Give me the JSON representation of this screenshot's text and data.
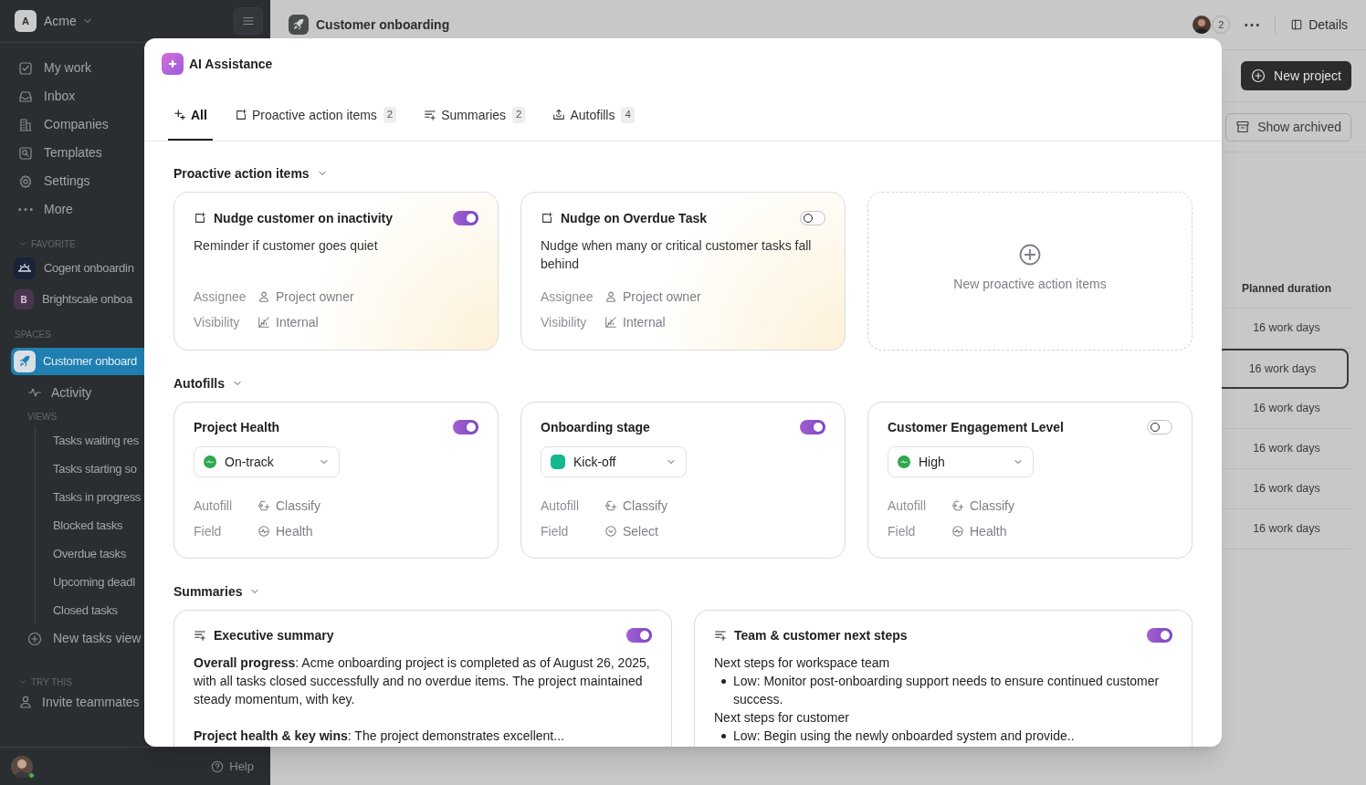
{
  "sidebar": {
    "workspace": {
      "initial": "A",
      "name": "Acme"
    },
    "nav": [
      {
        "kind": "my-work",
        "label": "My work"
      },
      {
        "kind": "inbox",
        "label": "Inbox"
      },
      {
        "kind": "companies",
        "label": "Companies"
      },
      {
        "kind": "templates",
        "label": "Templates"
      },
      {
        "kind": "settings",
        "label": "Settings"
      },
      {
        "kind": "more",
        "label": "More"
      }
    ],
    "favorites": {
      "heading": "FAVORITE",
      "items": [
        {
          "kind": "logo",
          "label": "Cogent onboardin"
        },
        {
          "kind": "letter",
          "initial": "B",
          "label": "Brightscale onboa"
        }
      ]
    },
    "spaces": {
      "heading": "SPACES",
      "items": [
        {
          "label": "Customer onboard",
          "selected": true
        }
      ]
    },
    "activity": "Activity",
    "views": {
      "heading": "VIEWS",
      "items": [
        "Tasks waiting res",
        "Tasks starting so",
        "Tasks in progress",
        "Blocked tasks",
        "Overdue tasks",
        "Upcoming deadl",
        "Closed tasks"
      ]
    },
    "new_view": "New tasks view",
    "try_this": {
      "heading": "TRY THIS",
      "items": [
        "Invite teammates"
      ]
    },
    "help": "Help"
  },
  "header": {
    "title": "Customer onboarding",
    "members": "2",
    "details": "Details"
  },
  "toolbar": {
    "new_project": "New project",
    "show_archived": "Show archived"
  },
  "table": {
    "column": "Planned duration",
    "rows": [
      {
        "value": "16 work days",
        "selected": false
      },
      {
        "value": "16 work days",
        "selected": true
      },
      {
        "value": "16 work days",
        "selected": false
      },
      {
        "value": "16 work days",
        "selected": false
      },
      {
        "value": "16 work days",
        "selected": false
      },
      {
        "value": "16 work days",
        "selected": false
      }
    ]
  },
  "modal": {
    "title": "AI Assistance",
    "tabs": [
      {
        "kind": "all",
        "label": "All",
        "selected": true
      },
      {
        "kind": "proactive",
        "label": "Proactive action items",
        "count": "2",
        "selected": false
      },
      {
        "kind": "summaries",
        "label": "Summaries",
        "count": "2",
        "selected": false
      },
      {
        "kind": "autofills",
        "label": "Autofills",
        "count": "4",
        "selected": false
      }
    ],
    "sections": [
      {
        "kind": "proactive",
        "heading": "Proactive action items",
        "cards": [
          {
            "title": "Nudge customer on inactivity",
            "description": "Reminder if customer goes quiet",
            "on": true,
            "fields": [
              {
                "kind": "assignee",
                "label": "Assignee",
                "value": "Project owner"
              },
              {
                "kind": "visibility",
                "label": "Visibility",
                "value": "Internal"
              }
            ]
          },
          {
            "title": "Nudge on Overdue Task",
            "description": "Nudge when many or critical customer tasks fall behind",
            "on": false,
            "fields": [
              {
                "kind": "assignee",
                "label": "Assignee",
                "value": "Project owner"
              },
              {
                "kind": "visibility",
                "label": "Visibility",
                "value": "Internal"
              }
            ]
          }
        ],
        "new_item": "New proactive action items"
      },
      {
        "kind": "autofill",
        "heading": "Autofills",
        "cards": [
          {
            "title": "Project Health",
            "on": true,
            "option": {
              "kind": "status",
              "label": "On-track",
              "color": "#2fa84f"
            },
            "fields": [
              {
                "kind": "classify",
                "label": "Autofill",
                "value": "Classify"
              },
              {
                "kind": "health",
                "label": "Field",
                "value": "Health"
              }
            ]
          },
          {
            "title": "Onboarding stage",
            "on": true,
            "option": {
              "kind": "stage",
              "label": "Kick-off",
              "color": "#14b88f"
            },
            "fields": [
              {
                "kind": "classify",
                "label": "Autofill",
                "value": "Classify"
              },
              {
                "kind": "select",
                "label": "Field",
                "value": "Select"
              }
            ]
          },
          {
            "title": "Customer Engagement Level",
            "on": false,
            "option": {
              "kind": "status",
              "label": "High",
              "color": "#2fa84f"
            },
            "fields": [
              {
                "kind": "classify",
                "label": "Autofill",
                "value": "Classify"
              },
              {
                "kind": "health",
                "label": "Field",
                "value": "Health"
              }
            ]
          }
        ]
      },
      {
        "kind": "summary",
        "heading": "Summaries",
        "cards": [
          {
            "title": "Executive summary",
            "on": true,
            "body": [
              {
                "kind": "paragraph",
                "text": "**Overall progress**: Acme onboarding project is completed as of August 26, 2025, with all tasks closed successfully and no overdue items. The project maintained steady momentum, with key."
              },
              {
                "kind": "paragraph",
                "text": "**Project health & key wins**: The project demonstrates excellent..."
              }
            ]
          },
          {
            "title": "Team & customer next steps",
            "on": true,
            "body": [
              {
                "kind": "line",
                "text": "Next steps for workspace team"
              },
              {
                "kind": "bullet",
                "text": "Low: Monitor post-onboarding support needs to ensure continued customer success."
              },
              {
                "kind": "line",
                "text": "Next steps for customer"
              },
              {
                "kind": "bullet",
                "text": "Low: Begin using the newly onboarded system and provide.."
              }
            ]
          }
        ]
      }
    ]
  }
}
